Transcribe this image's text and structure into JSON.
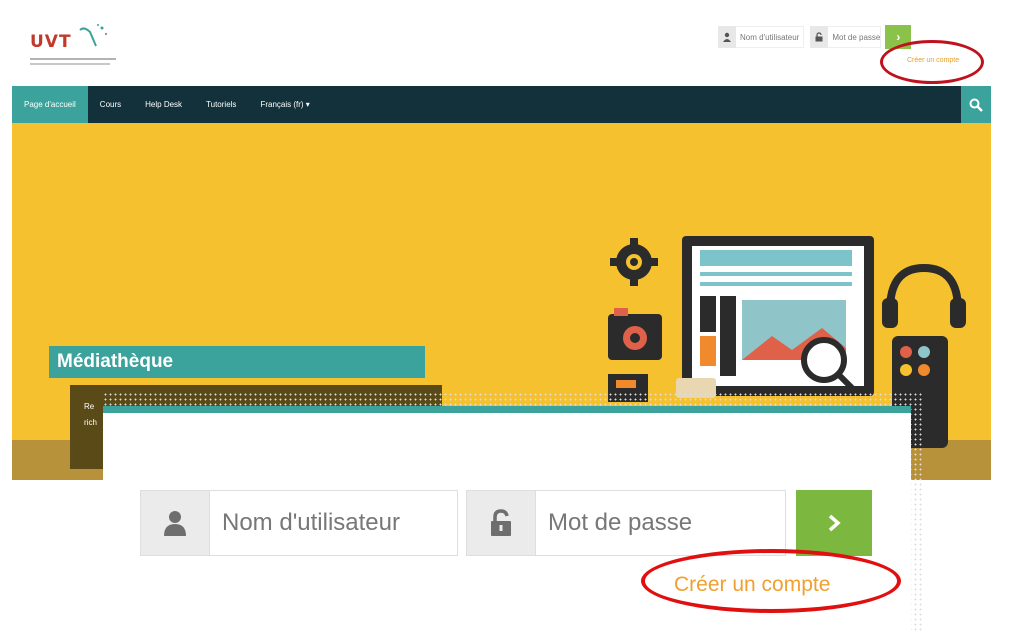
{
  "header": {
    "logo_text": "UVT",
    "username_placeholder": "Nom d'utilisateur",
    "password_placeholder": "Mot de passe",
    "create_account": "Créer un compte"
  },
  "nav": {
    "items": [
      {
        "label": "Page d'accueil",
        "active": true
      },
      {
        "label": "Cours"
      },
      {
        "label": "Help Desk"
      },
      {
        "label": "Tutoriels"
      },
      {
        "label": "Français (fr) ▾"
      }
    ]
  },
  "hero": {
    "title": "Médiathèque",
    "desc_line1": "Re",
    "desc_line2": "rich"
  },
  "zoomed": {
    "username_placeholder": "Nom d'utilisateur",
    "password_placeholder": "Mot de passe",
    "create_account": "Créer un compte"
  },
  "colors": {
    "teal": "#3ba39c",
    "navbar": "#13313b",
    "hero": "#f5c12e",
    "green_button": "#7cb83f",
    "link_orange": "#f0a030",
    "annotation_red": "#e01010"
  },
  "icons": [
    "user-icon",
    "lock-icon",
    "chevron-right-icon",
    "search-icon"
  ]
}
